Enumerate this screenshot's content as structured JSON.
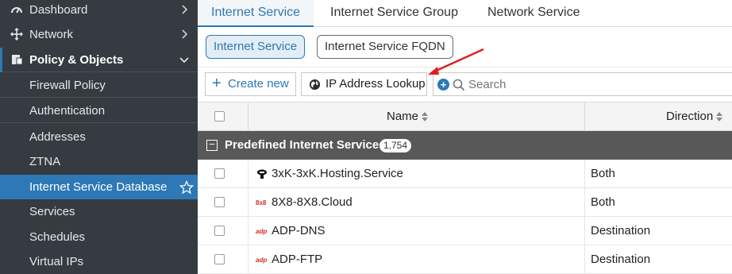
{
  "sidebar": {
    "items": [
      {
        "label": "Dashboard",
        "icon": "dashboard-icon"
      },
      {
        "label": "Network",
        "icon": "network-icon"
      },
      {
        "label": "Policy & Objects",
        "icon": "policy-objects-icon"
      }
    ],
    "subitems": [
      {
        "label": "Firewall Policy"
      },
      {
        "label": "Authentication"
      },
      {
        "label": "Addresses"
      },
      {
        "label": "ZTNA"
      },
      {
        "label": "Internet Service Database",
        "active": true
      },
      {
        "label": "Services"
      },
      {
        "label": "Schedules"
      },
      {
        "label": "Virtual IPs"
      }
    ]
  },
  "tabs": [
    {
      "label": "Internet Service",
      "selected": true
    },
    {
      "label": "Internet Service Group"
    },
    {
      "label": "Network Service"
    }
  ],
  "subtabs": [
    {
      "label": "Internet Service",
      "selected": true
    },
    {
      "label": "Internet Service FQDN"
    }
  ],
  "toolbar": {
    "create_label": "Create new",
    "lookup_label": "IP Address Lookup",
    "search_placeholder": "Search"
  },
  "table": {
    "columns": [
      "Name",
      "Direction"
    ],
    "group": {
      "label": "Predefined Internet Services",
      "count": "1,754"
    },
    "rows": [
      {
        "name": "3xK-3xK.Hosting.Service",
        "direction": "Both",
        "icon": "hosting-service-icon"
      },
      {
        "name": "8X8-8X8.Cloud",
        "direction": "Both",
        "icon": "8x8-logo-icon"
      },
      {
        "name": "ADP-DNS",
        "direction": "Destination",
        "icon": "adp-logo-icon"
      },
      {
        "name": "ADP-FTP",
        "direction": "Destination",
        "icon": "adp-logo-icon"
      }
    ]
  },
  "colors": {
    "sidebar_bg": "#353b40",
    "accent": "#2d78b5",
    "group_row_bg": "#585858",
    "annotation_arrow": "#e02020"
  }
}
